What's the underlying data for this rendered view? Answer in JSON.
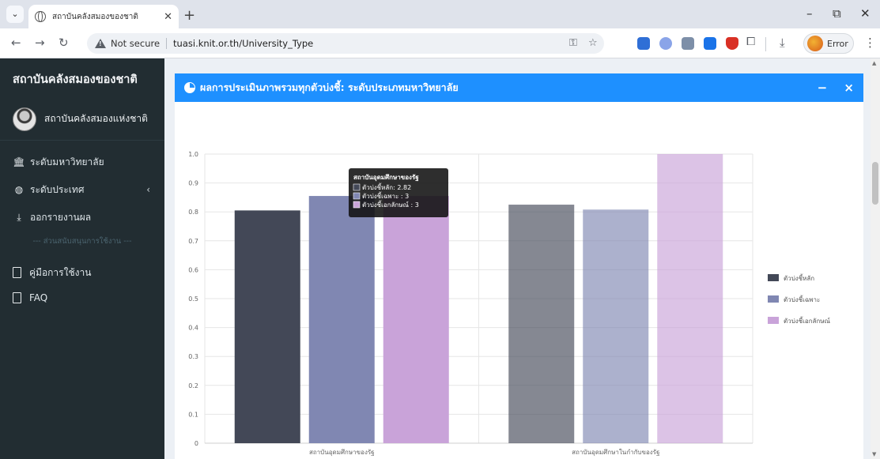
{
  "browser": {
    "tab_title": "สถาบันคลังสมองของชาติ",
    "not_secure": "Not secure",
    "url": "tuasi.knit.or.th/University_Type",
    "profile_status": "Error"
  },
  "sidebar": {
    "brand": "สถาบันคลังสมองของชาติ",
    "user": "สถาบันคลังสมองแห่งชาติ",
    "items": [
      {
        "label": "ระดับมหาวิทยาลัย",
        "icon": "university-icon"
      },
      {
        "label": "ระดับประเทศ",
        "icon": "globe-icon"
      },
      {
        "label": "ออกรายงานผล",
        "icon": "download-icon"
      }
    ],
    "section_header": "--- ส่วนสนับสนุนการใช้งาน ---",
    "support_items": [
      {
        "label": "คู่มือการใช้งาน",
        "icon": "file-icon"
      },
      {
        "label": "FAQ",
        "icon": "file-icon"
      }
    ]
  },
  "box": {
    "title": "ผลการประเมินภาพรวมทุกตัวบ่งชี้: ระดับประเภทมหาวิทยาลัย",
    "minimize": "−",
    "close": "×"
  },
  "chart_data": {
    "type": "bar",
    "categories": [
      "สถาบันอุดมศึกษาของรัฐ",
      "สถาบันอุดมศึกษาในกำกับของรัฐ"
    ],
    "series": [
      {
        "name": "ตัวบ่งชี้หลัก",
        "color": "#434857",
        "values": [
          0.805,
          0.825
        ]
      },
      {
        "name": "ตัวบ่งชี้เฉพาะ",
        "color": "#8087b2",
        "values": [
          0.855,
          0.808
        ]
      },
      {
        "name": "ตัวบ่งชี้เอกลักษณ์",
        "color": "#c9a3d9",
        "values": [
          0.855,
          1.0
        ]
      }
    ],
    "faded_category_index": 1,
    "yticks": [
      "0",
      "0.1",
      "0.2",
      "0.3",
      "0.4",
      "0.5",
      "0.6",
      "0.7",
      "0.8",
      "0.9",
      "1.0"
    ],
    "ylim": [
      0,
      1.0
    ],
    "legend_position": "right",
    "tooltip": {
      "category_index": 0,
      "title": "สถาบันอุดมศึกษาของรัฐ",
      "lines": [
        "ตัวบ่งชี้หลัก: 2.82",
        "ตัวบ่งชี้เฉพาะ : 3",
        "ตัวบ่งชี้เอกลักษณ์ : 3"
      ]
    }
  }
}
